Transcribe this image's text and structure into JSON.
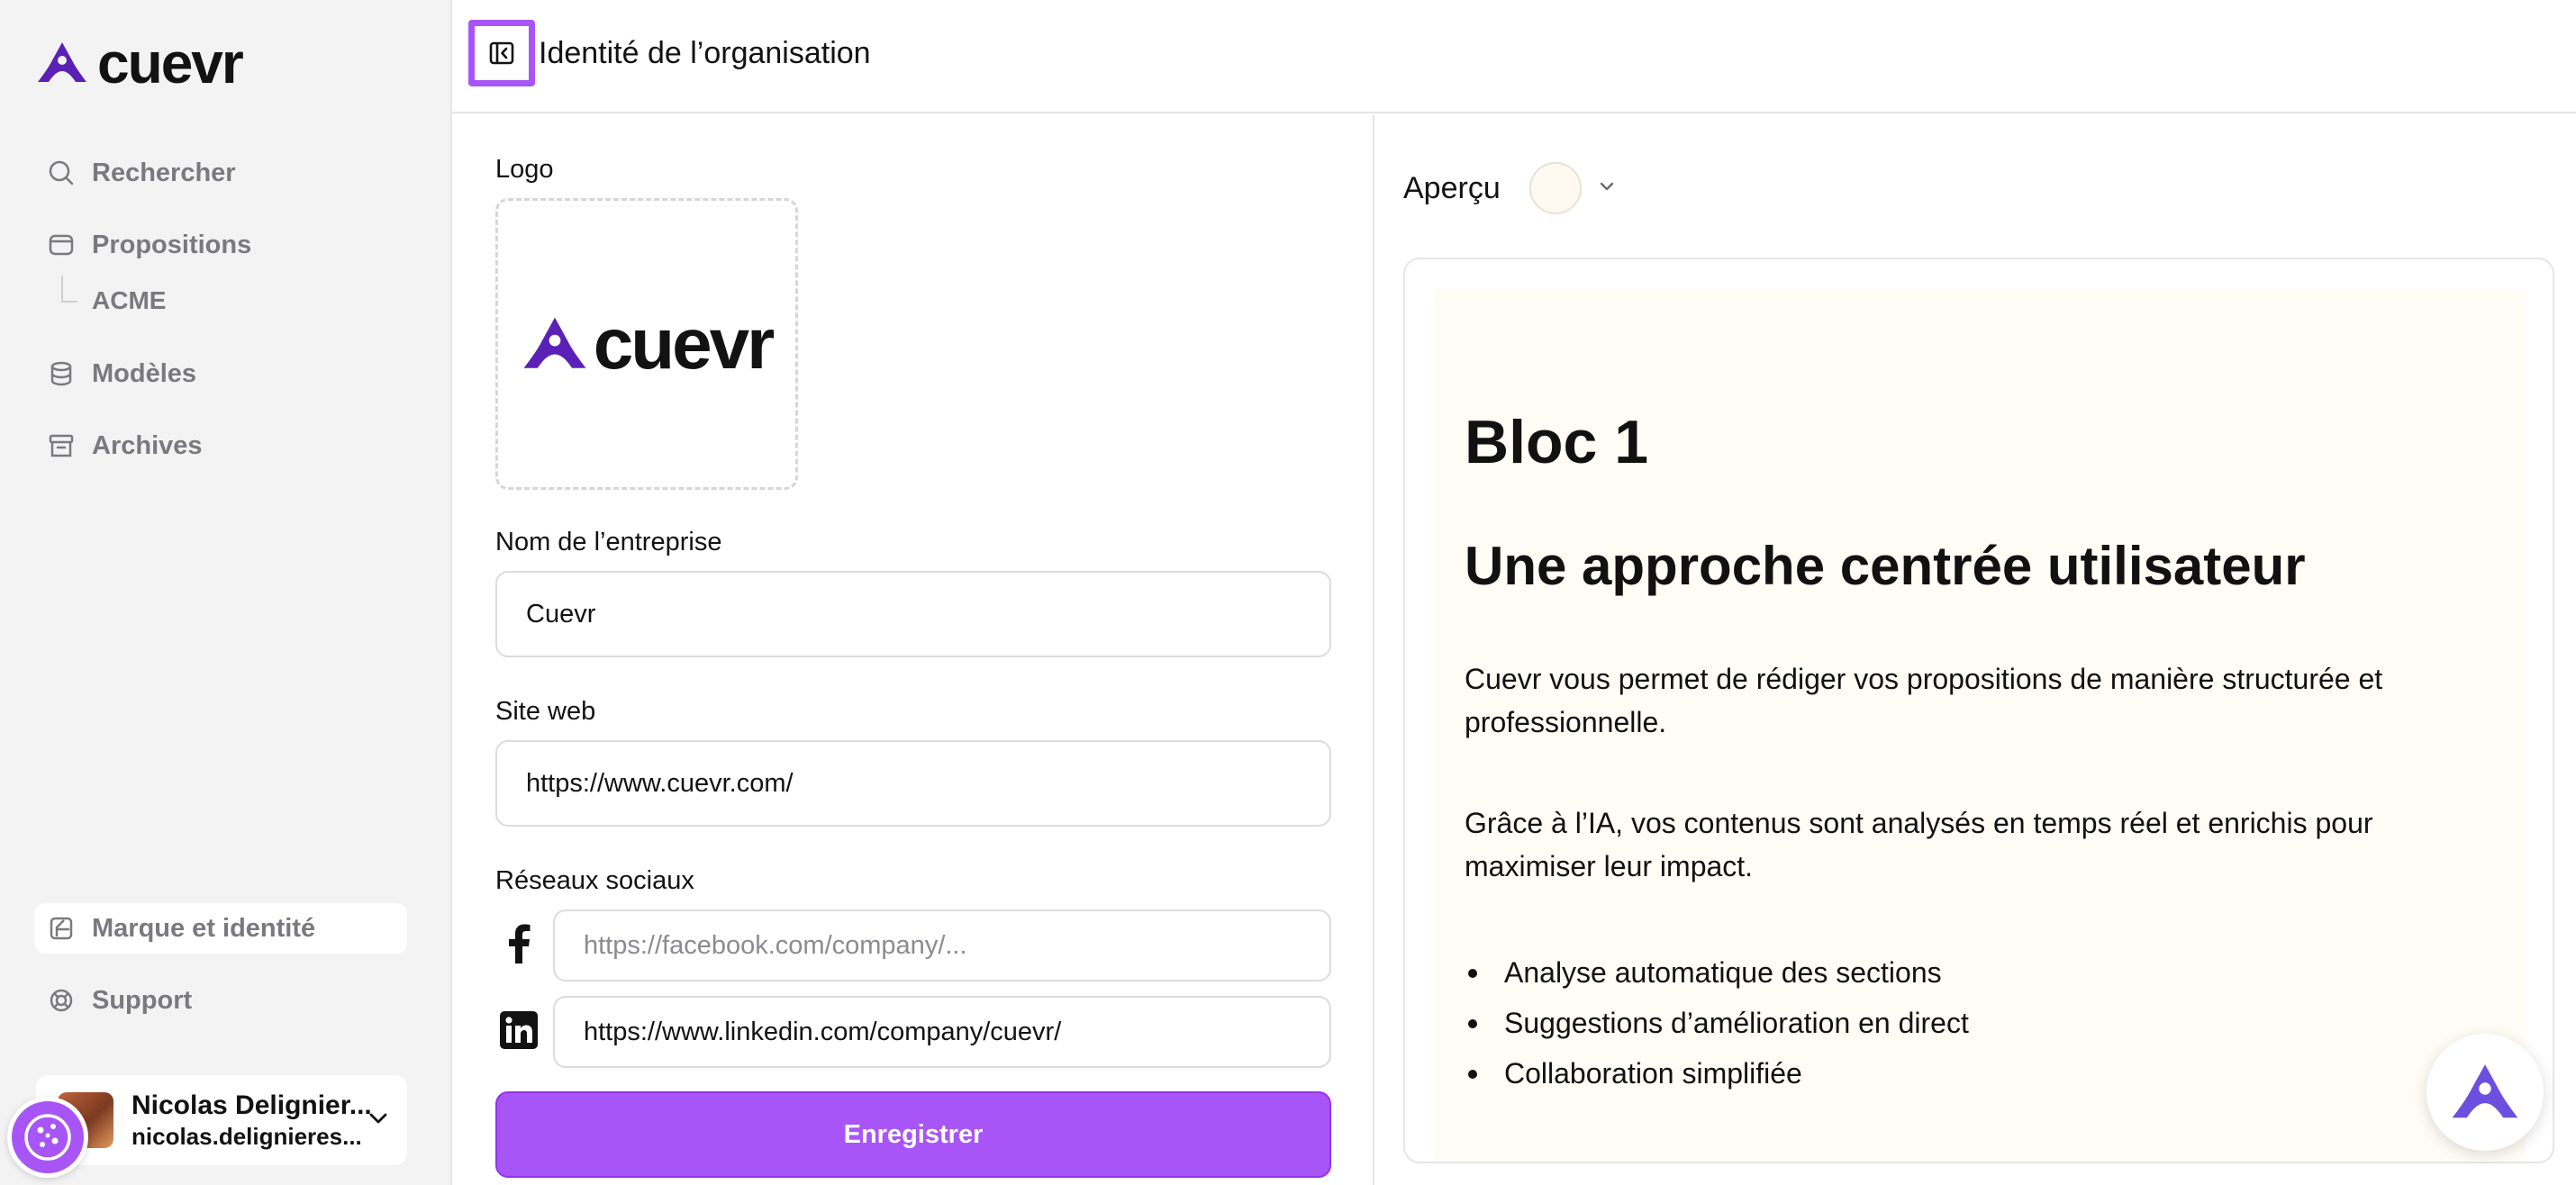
{
  "brand": {
    "name": "cuevr"
  },
  "sidebar": {
    "items": [
      {
        "label": "Rechercher",
        "icon": "search-icon"
      },
      {
        "label": "Propositions",
        "icon": "proposals-icon"
      },
      {
        "label": "Modèles",
        "icon": "database-icon"
      },
      {
        "label": "Archives",
        "icon": "archive-icon"
      }
    ],
    "sub_item": "ACME",
    "bottom_items": [
      {
        "label": "Marque et identité",
        "icon": "brand-icon",
        "active": true
      },
      {
        "label": "Support",
        "icon": "lifebuoy-icon"
      }
    ],
    "user": {
      "name": "Nicolas Delignier...",
      "email": "nicolas.delignieres..."
    }
  },
  "header": {
    "title": "Identité de l’organisation"
  },
  "form": {
    "logo_label": "Logo",
    "logo_word": "cuevr",
    "company_label": "Nom de l’entreprise",
    "company_value": "Cuevr",
    "website_label": "Site web",
    "website_value": "https://www.cuevr.com/",
    "social_label": "Réseaux sociaux",
    "facebook_placeholder": "https://facebook.com/company/...",
    "linkedin_value": "https://www.linkedin.com/company/cuevr/",
    "save_label": "Enregistrer"
  },
  "preview": {
    "label": "Aperçu",
    "selected_color": "#fffaf1",
    "h1": "Bloc 1",
    "h2": "Une approche centrée utilisateur",
    "p1": "Cuevr vous permet de rédiger vos propositions de manière structurée et professionnelle.",
    "p2": "Grâce à l’IA, vos contenus sont analysés en temps réel et enrichis pour maximiser leur impact.",
    "bullets": [
      "Analyse automatique des sections",
      "Suggestions d’amélioration en direct",
      "Collaboration simplifiée"
    ]
  },
  "colors": {
    "accent": "#a855f7",
    "brand_purple": "#5b21b6",
    "preview_bg": "#fffcf5"
  }
}
